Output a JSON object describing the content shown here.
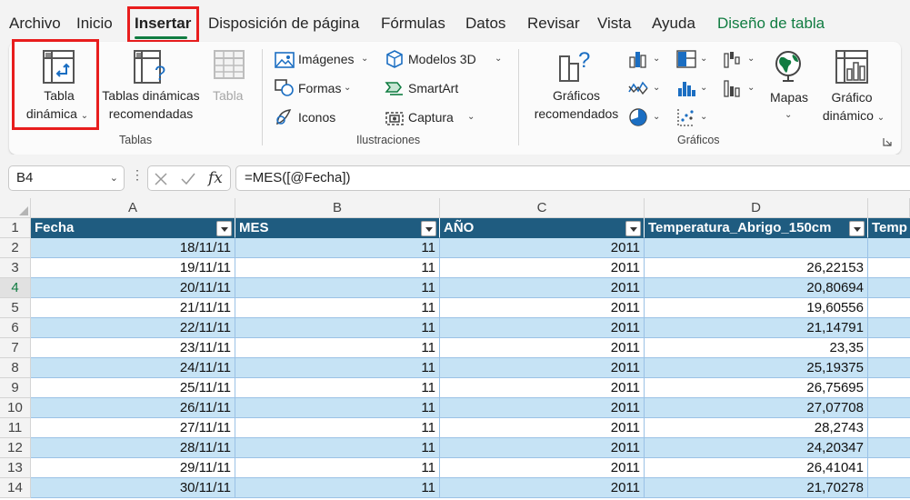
{
  "menu": {
    "tabs": [
      "Archivo",
      "Inicio",
      "Insertar",
      "Disposición de página",
      "Fórmulas",
      "Datos",
      "Revisar",
      "Vista",
      "Ayuda",
      "Diseño de tabla"
    ]
  },
  "ribbon": {
    "tablas": {
      "group_label": "Tablas",
      "pivot_line1": "Tabla",
      "pivot_line2": "dinámica",
      "rec_line1": "Tablas dinámicas",
      "rec_line2": "recomendadas",
      "table_label": "Tabla"
    },
    "ilustraciones": {
      "group_label": "Ilustraciones",
      "imagenes": "Imágenes",
      "formas": "Formas",
      "iconos": "Iconos",
      "modelos3d": "Modelos 3D",
      "smartart": "SmartArt",
      "captura": "Captura"
    },
    "graficos": {
      "group_label": "Gráficos",
      "rec_line1": "Gráficos",
      "rec_line2": "recomendados",
      "mapas": "Mapas",
      "pivotchart_line1": "Gráfico",
      "pivotchart_line2": "dinámico"
    }
  },
  "formula_bar": {
    "name_box": "B4",
    "fx_label": "fx",
    "formula": "=MES([@Fecha])"
  },
  "grid": {
    "columns": [
      "A",
      "B",
      "C",
      "D"
    ],
    "row_numbers": [
      "1",
      "2",
      "3",
      "4",
      "5",
      "6",
      "7",
      "8",
      "9",
      "10",
      "11",
      "12",
      "13",
      "14"
    ],
    "selected_row": "4",
    "headers": [
      "Fecha",
      "MES",
      "AÑO",
      "Temperatura_Abrigo_150cm",
      "Temp"
    ],
    "rows": [
      [
        "18/11/11",
        "11",
        "2011",
        ""
      ],
      [
        "19/11/11",
        "11",
        "2011",
        "26,22153"
      ],
      [
        "20/11/11",
        "11",
        "2011",
        "20,80694"
      ],
      [
        "21/11/11",
        "11",
        "2011",
        "19,60556"
      ],
      [
        "22/11/11",
        "11",
        "2011",
        "21,14791"
      ],
      [
        "23/11/11",
        "11",
        "2011",
        "23,35"
      ],
      [
        "24/11/11",
        "11",
        "2011",
        "25,19375"
      ],
      [
        "25/11/11",
        "11",
        "2011",
        "26,75695"
      ],
      [
        "26/11/11",
        "11",
        "2011",
        "27,07708"
      ],
      [
        "27/11/11",
        "11",
        "2011",
        "28,2743"
      ],
      [
        "28/11/11",
        "11",
        "2011",
        "24,20347"
      ],
      [
        "29/11/11",
        "11",
        "2011",
        "26,41041"
      ],
      [
        "30/11/11",
        "11",
        "2011",
        "21,70278"
      ]
    ]
  },
  "colors": {
    "accent": "#107c41",
    "highlight": "#e81d1d",
    "table_header": "#1f5c80",
    "band": "#c6e3f5"
  }
}
